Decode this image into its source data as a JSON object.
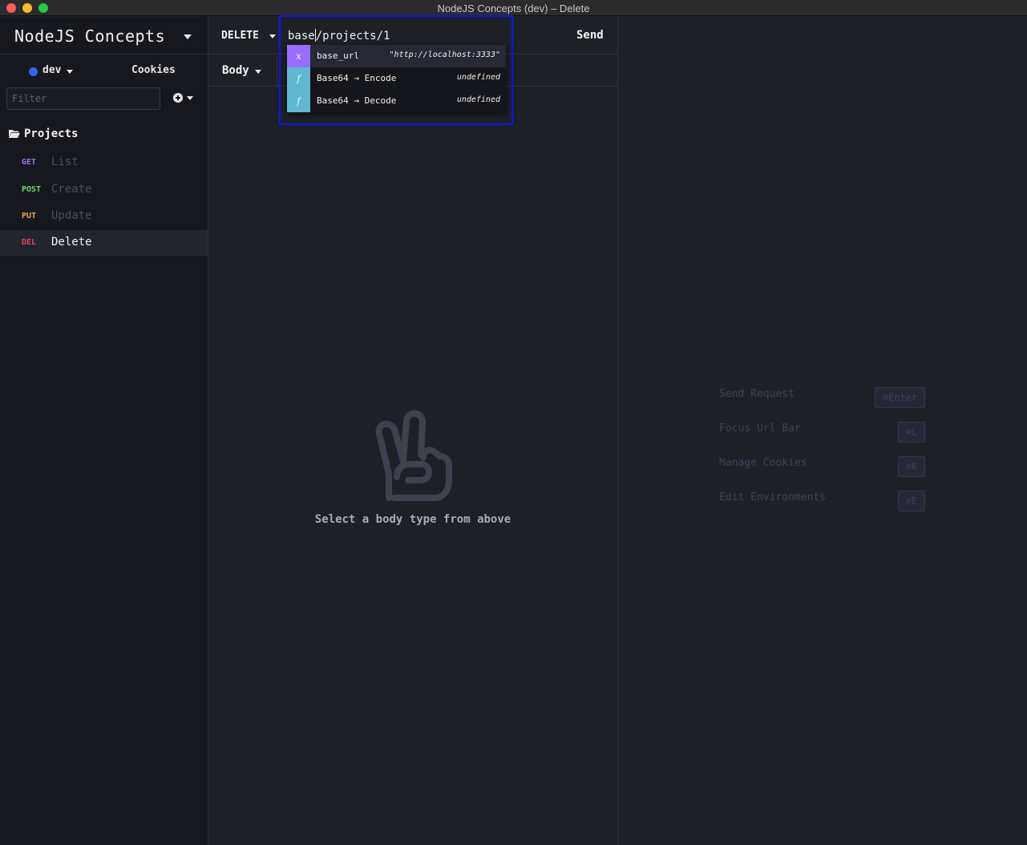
{
  "window": {
    "title": "NodeJS Concepts (dev) – Delete"
  },
  "sidebar": {
    "workspace_name": "NodeJS Concepts",
    "environment": {
      "name": "dev",
      "color": "#2e67f0"
    },
    "cookies_label": "Cookies",
    "filter_placeholder": "Filter",
    "folder": {
      "name": "Projects",
      "icon": "folder-open-icon"
    },
    "requests": [
      {
        "method": "GET",
        "method_color": "#a76cf0",
        "name": "List",
        "active": false
      },
      {
        "method": "POST",
        "method_color": "#6ed86b",
        "name": "Create",
        "active": false
      },
      {
        "method": "PUT",
        "method_color": "#e8a14a",
        "name": "Update",
        "active": false
      },
      {
        "method": "DEL",
        "method_color": "#e0465c",
        "name": "Delete",
        "active": true
      }
    ]
  },
  "request": {
    "method": "DELETE",
    "url_before_cursor": "base",
    "url_after_cursor": "/projects/1",
    "send_label": "Send",
    "body_tab_label": "Body",
    "empty_message": "Select a body type from above"
  },
  "autocomplete": {
    "items": [
      {
        "badge": "x",
        "kind": "variable",
        "name": "base_url",
        "value": "\"http://localhost:3333\"",
        "selected": true
      },
      {
        "badge": "f",
        "kind": "function",
        "name": "Base64 → Encode",
        "value": "undefined",
        "selected": false
      },
      {
        "badge": "f",
        "kind": "function",
        "name": "Base64 → Decode",
        "value": "undefined",
        "selected": false
      }
    ]
  },
  "response": {
    "hints": [
      {
        "label": "Send Request",
        "key": "⌘Enter"
      },
      {
        "label": "Focus Url Bar",
        "key": "⌘L"
      },
      {
        "label": "Manage Cookies",
        "key": "⌘K"
      },
      {
        "label": "Edit Environments",
        "key": "⌘E"
      }
    ]
  }
}
